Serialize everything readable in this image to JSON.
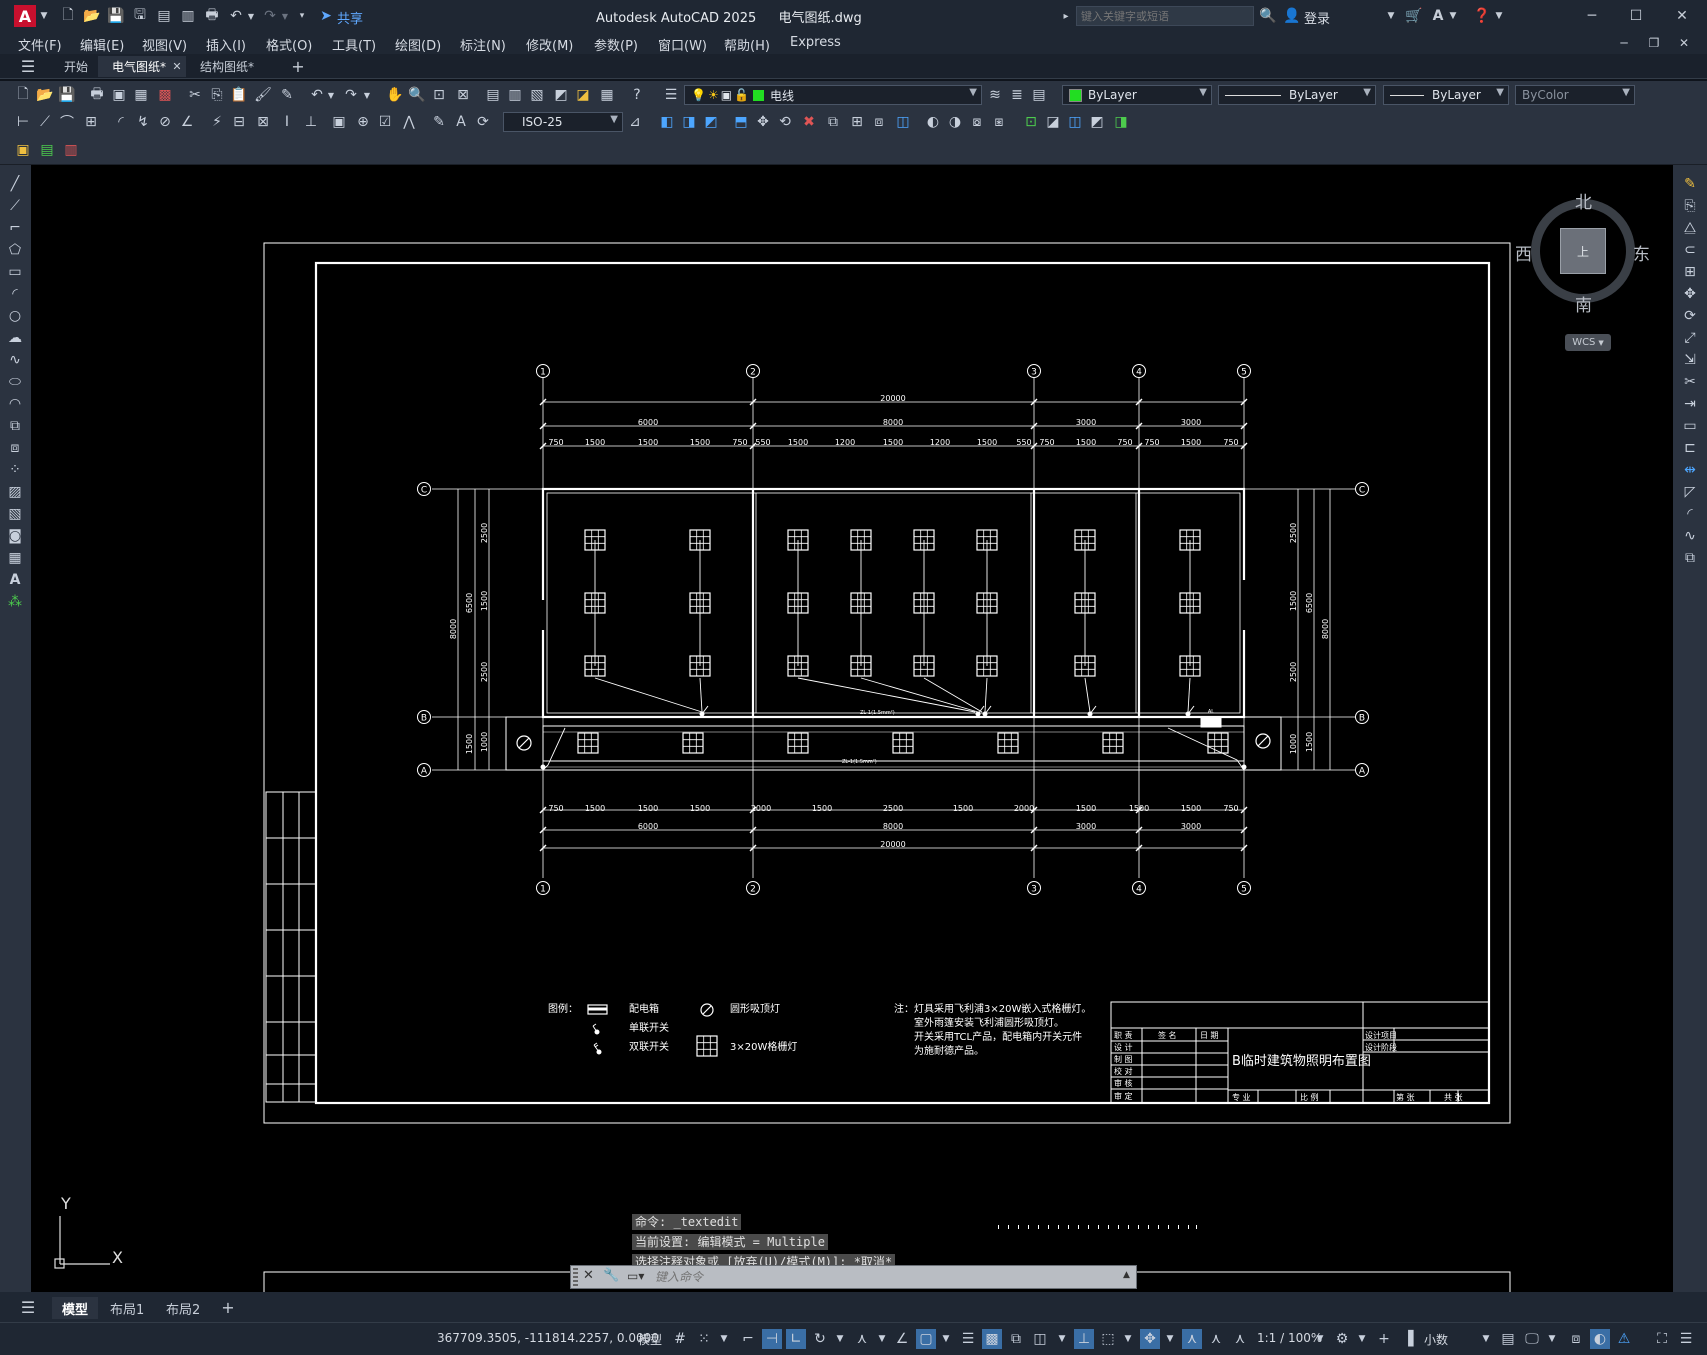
{
  "app": {
    "title": "Autodesk AutoCAD 2025",
    "filename": "电气图纸.dwg",
    "share_label": "共享",
    "search_placeholder": "键入关键字或短语",
    "login_label": "登录"
  },
  "menu": [
    "文件(F)",
    "编辑(E)",
    "视图(V)",
    "插入(I)",
    "格式(O)",
    "工具(T)",
    "绘图(D)",
    "标注(N)",
    "修改(M)",
    "参数(P)",
    "窗口(W)",
    "帮助(H)",
    "Express"
  ],
  "doc_tabs": [
    {
      "label": "开始",
      "active": false
    },
    {
      "label": "电气图纸*",
      "active": true
    },
    {
      "label": "结构图纸*",
      "active": false
    }
  ],
  "toolbar": {
    "layer": "电线",
    "color": "ByLayer",
    "linetype": "ByLayer",
    "lineweight": "ByLayer",
    "plotstyle": "ByColor",
    "dimstyle": "ISO-25"
  },
  "viewcube": {
    "north": "北",
    "south": "南",
    "east": "东",
    "west": "西",
    "top_label": "上",
    "wcs": "WCS"
  },
  "ucs": {
    "x": "X",
    "y": "Y"
  },
  "drawing": {
    "grid_top": [
      "1",
      "2",
      "3",
      "4",
      "5"
    ],
    "grid_side": [
      "C",
      "B",
      "A"
    ],
    "dim_total": "20000",
    "dim_bays": [
      "6000",
      "8000",
      "3000",
      "3000"
    ],
    "dim_top_detail": [
      "750",
      "1500",
      "1500",
      "1500",
      "750",
      "550",
      "1500",
      "1200",
      "1500",
      "1200",
      "1500",
      "550",
      "750",
      "1500",
      "750",
      "750",
      "1500",
      "750"
    ],
    "dim_bottom_detail": [
      "750",
      "1500",
      "1500",
      "1500",
      "2000",
      "1500",
      "2500",
      "1500",
      "2000",
      "1500",
      "1500",
      "1500",
      "750"
    ],
    "dim_left": [
      "8000",
      "6500",
      "2500",
      "1500",
      "2500",
      "1500",
      "1000"
    ],
    "dim_right": [
      "2500",
      "1500",
      "2500",
      "6500",
      "8000",
      "1000",
      "1500"
    ],
    "circuit_label": "ZL-1(1.5mm²)",
    "legend_title": "图例：",
    "legend": [
      {
        "symbol": "panel",
        "label": "配电箱"
      },
      {
        "symbol": "single-switch",
        "label": "单联开关"
      },
      {
        "symbol": "double-switch",
        "label": "双联开关"
      },
      {
        "symbol": "ceiling-lamp",
        "label": "圆形吸顶灯"
      },
      {
        "symbol": "grille-lamp",
        "label": "3×20W格栅灯"
      }
    ],
    "notes_title": "注：",
    "notes": [
      "灯具采用飞利浦3×20W嵌入式格栅灯。",
      "室外雨篷安装飞利浦圆形吸顶灯。",
      "开关采用TCL产品，配电箱内开关元件",
      "为施耐德产品。"
    ],
    "title_block": {
      "drawing_title": "B临时建筑物照明布置图",
      "roles": [
        "职 责",
        "设 计",
        "制 图",
        "校 对",
        "审 核",
        "审 定"
      ],
      "headers": [
        "签 名",
        "日 期"
      ],
      "right_top": [
        "设计项目",
        "设计阶段"
      ],
      "bottom": [
        "专 业",
        "比 例",
        "第 张",
        "共 张"
      ]
    }
  },
  "command": {
    "history": [
      "命令: _textedit",
      "当前设置: 编辑模式 = Multiple",
      "选择注释对象或 [放弃(U)/模式(M)]: *取消*"
    ],
    "input_placeholder": "键入命令"
  },
  "layout_tabs": [
    {
      "label": "模型",
      "active": true
    },
    {
      "label": "布局1",
      "active": false
    },
    {
      "label": "布局2",
      "active": false
    }
  ],
  "status": {
    "coords": "367709.3505, -111814.2257, 0.0000",
    "model": "模型",
    "scale": "1:1 / 100%",
    "units": "小数"
  }
}
